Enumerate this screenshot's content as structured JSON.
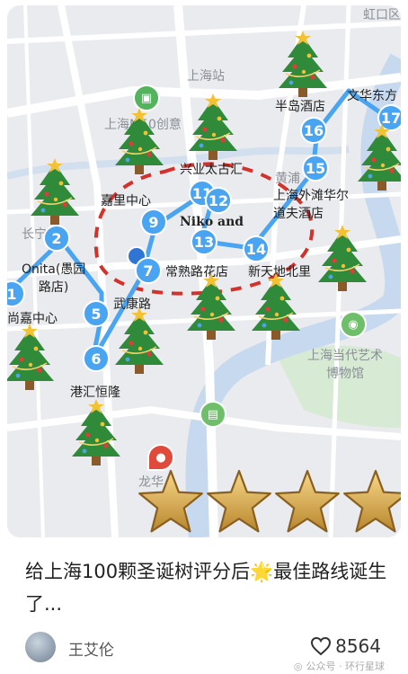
{
  "map": {
    "labels": {
      "hongkou": "虹口区",
      "shanghai_station": "上海站",
      "m50": "上海M50创意",
      "xingye": "兴业太古汇",
      "jiali": "嘉里中心",
      "niko": "Niko and",
      "huangpu": "黄浦",
      "peninsula": "半岛酒店",
      "mandarin": "文华东方",
      "waldorf": "上海外滩华尔\n道夫酒店",
      "changning": "长宁",
      "onita": "Onita(愚园\n路店)",
      "changshu": "常熟路花店",
      "xintiandi": "新天地北里",
      "wukang": "武康路",
      "shangjia": "尚嘉中心",
      "gangui": "港汇恒隆",
      "psa": "上海当代艺术\n博物馆",
      "longhua": "龙华"
    },
    "markers": [
      "1",
      "2",
      "5",
      "6",
      "7",
      "9",
      "11",
      "12",
      "13",
      "14",
      "15",
      "16",
      "17"
    ],
    "route_color": "#49a4f2",
    "dash_color": "#d3322c"
  },
  "rating": {
    "stars": 4
  },
  "post": {
    "title": "给上海100颗圣诞树评分后🌟最佳路线诞生了...",
    "author": "王艾伦",
    "likes": "8564",
    "watermark": "公众号 · 环行星球"
  }
}
